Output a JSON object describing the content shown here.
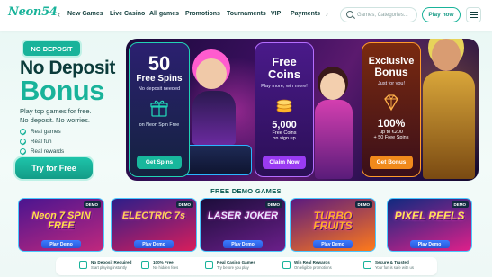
{
  "header": {
    "logo": "Neon54",
    "nav": [
      "New Games",
      "Live Casino",
      "All games",
      "Promotions",
      "Tournaments",
      "VIP",
      "Payments"
    ],
    "search_placeholder": "Games, Categories...",
    "play_now": "Play now"
  },
  "hero": {
    "badge": "NO DEPOSIT",
    "title_line1": "No Deposit",
    "title_line2": "Bonus",
    "subtitle_line1": "Play top games for free.",
    "subtitle_line2": "No deposit. No worries.",
    "features": [
      "Real games",
      "Real fun",
      "Real rewards"
    ],
    "cta": "Try for Free"
  },
  "promo_cards": [
    {
      "big": "50",
      "title": "Free Spins",
      "small": "No deposit needed",
      "note": "on Neon Spin Free",
      "button": "Get Spins"
    },
    {
      "big": "Free",
      "title": "Coins",
      "small": "Play more, win more!",
      "mid": "5,000",
      "mid2": "Free Coins\non sign up",
      "button": "Claim Now"
    },
    {
      "big": "Exclusive",
      "title": "Bonus",
      "small": "Just for you!",
      "mid": "100%",
      "mid2": "up to €200\n+ 50 Free Spins",
      "button": "Get Bonus"
    }
  ],
  "demo": {
    "heading": "FREE DEMO GAMES",
    "badge": "DEMO",
    "button": "Play Demo",
    "games": [
      "Neon 7 SPIN FREE",
      "ELECTRIC 7s",
      "LASER JOKER",
      "TURBO FRUITS",
      "PIXEL REELS"
    ]
  },
  "trust": [
    {
      "title": "No Deposit Required",
      "sub": "Start playing instantly"
    },
    {
      "title": "100% Free",
      "sub": "No hidden fees"
    },
    {
      "title": "Real Casino Games",
      "sub": "Try before you play"
    },
    {
      "title": "Win Real Rewards",
      "sub": "On eligible promotions"
    },
    {
      "title": "Secure & Trusted",
      "sub": "Your fun is safe with us"
    }
  ],
  "colors": {
    "accent": "#19b39a",
    "dark": "#0b3b3a",
    "promo_bg": "#3a0f5e"
  }
}
